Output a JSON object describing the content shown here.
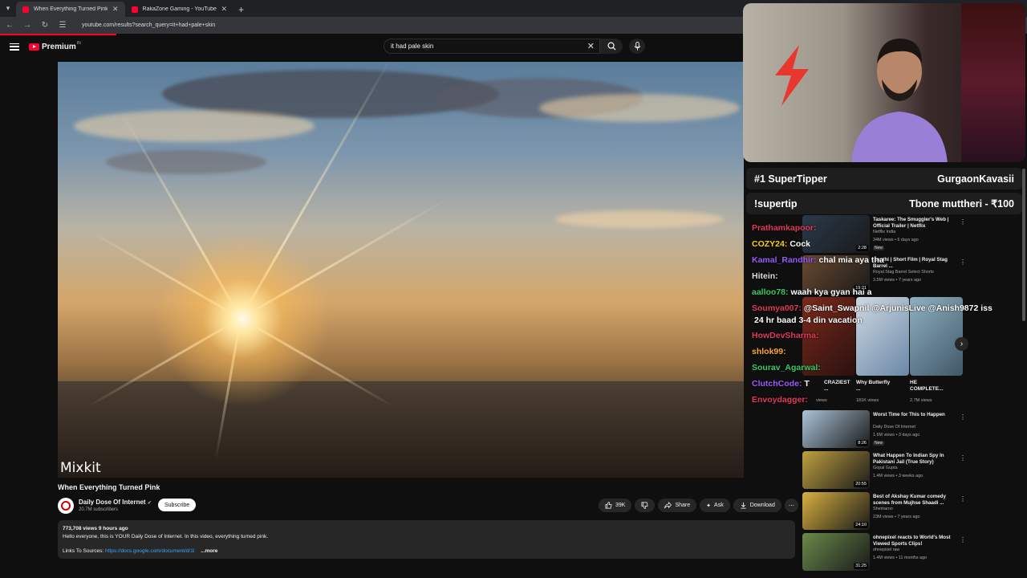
{
  "browser": {
    "tabs": [
      {
        "label": "When Everything Turned Pink",
        "active": true
      },
      {
        "label": "RakaZone Gaming - YouTube",
        "active": false
      }
    ],
    "url": "youtube.com/results?search_query=it+had+pale+skin"
  },
  "header": {
    "logo_text": "Premium",
    "logo_region": "IN",
    "search_value": "it had pale skin"
  },
  "video": {
    "watermark": "Mixkit",
    "title": "When Everything Turned Pink",
    "channel": "Daily Dose Of Internet",
    "subscribers": "20.7M subscribers",
    "subscribe_label": "Subscribe",
    "likes": "39K",
    "share_label": "Share",
    "ask_label": "Ask",
    "download_label": "Download",
    "views_time": "773,708 views  9 hours ago",
    "description_line": "Hello everyone, this is YOUR Daily Dose of Internet. In this video, everything turned pink.",
    "sources_label": "Links To Sources: ",
    "sources_link": "https://docs.google.com/document/d/1l",
    "more_label": "...more"
  },
  "overlay": {
    "tipper_label": "#1 SuperTipper",
    "tipper_name": "GurgaonKavasii",
    "supertip_cmd": "!supertip",
    "supertip_info": "Tbone muttheri - ₹100"
  },
  "chat": [
    {
      "user": "Prathamkapoor:",
      "msg": "",
      "color": "#e23a5a"
    },
    {
      "user": "COZY24:",
      "msg": "Cock",
      "color": "#ffd200"
    },
    {
      "user": "Kamal_Randhir:",
      "msg": "chal mia aya tha",
      "color": "#9b59ff"
    },
    {
      "user": "Hitein:",
      "msg": "",
      "color": "#dddddd"
    },
    {
      "user": "aalloo78:",
      "msg": "waah kya gyan hai a",
      "color": "#33cc66"
    },
    {
      "user": "Soumya007:",
      "msg": "@Saint_Swapnil @ArjunisLive @Anish9872 iss",
      "color": "#e23a5a"
    },
    {
      "user": "",
      "msg": "24 hr baad 3-4 din vacation",
      "color": "#ffffff"
    },
    {
      "user": "HowDevSharma:",
      "msg": "",
      "color": "#e23a5a"
    },
    {
      "user": "shlok99:",
      "msg": "",
      "color": "#ffaa33"
    },
    {
      "user": "Sourav_Agarwal:",
      "msg": "",
      "color": "#33cc66"
    },
    {
      "user": "ClutchCode:",
      "msg": "T",
      "color": "#9b59ff"
    },
    {
      "user": "Envoydagger:",
      "msg": "",
      "color": "#e23a5a"
    }
  ],
  "sidebar": {
    "top_items": [
      {
        "title": "Taskaree: The Smuggler's Web | Official Trailer | Netflix",
        "channel": "Netflix India",
        "views": "34M views • 6 days ago",
        "badge": "New",
        "duration": "2:28"
      },
      {
        "title": "...anthi | Short Film | Royal Stag Barrel ...",
        "channel": "Royal Stag Barrel Select Shorts",
        "views": "3.5M views • 7 years ago",
        "badge": "",
        "duration": "19:21"
      }
    ],
    "shorts": [
      {
        "label": "CRAZIEST ...",
        "views": "views"
      },
      {
        "label": "Why Butterfly ...",
        "views": "181K views"
      },
      {
        "label": "HE COMPLETE...",
        "views": "2.7M views"
      }
    ],
    "items": [
      {
        "title": "Worst Time for This to Happen",
        "channel": "Daily Dose Of Internet",
        "views": "1.6M views • 3 days ago",
        "badge": "New",
        "duration": "8:26"
      },
      {
        "title": "What Happen To Indian Spy In Pakistani Jail (True Story)",
        "channel": "Gopal Gupta",
        "views": "1.4M views • 3 weeks ago",
        "badge": "",
        "duration": "20:55"
      },
      {
        "title": "Best of Akshay Kumar comedy scenes from  Mujhse Shaadi ...",
        "channel": "Shemaroo",
        "views": "23M views • 7 years ago",
        "badge": "",
        "duration": "24:10"
      },
      {
        "title": "ohnepixel reacts to World's Most Viewed Sports Clips!",
        "channel": "ohnepixel raw",
        "views": "1.4M views • 11 months ago",
        "badge": "",
        "duration": "31:25"
      }
    ]
  }
}
